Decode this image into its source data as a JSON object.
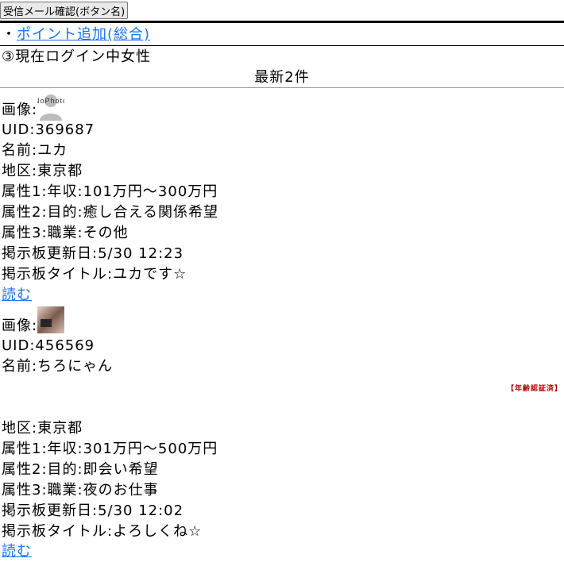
{
  "toolbar": {
    "mail_button": "受信メール確認(ボタン名)"
  },
  "points_link": {
    "bullet": "・",
    "label": "ポイント追加(総合)"
  },
  "section": {
    "heading": "③現在ログイン中女性",
    "subheading": "最新2件"
  },
  "profiles": [
    {
      "image_label": "画像:",
      "image_text": "NoPhoto",
      "uid": "UID:369687",
      "name": "名前:ユカ",
      "badge": "",
      "area": "地区:東京都",
      "attr1": "属性1:年収:101万円〜300万円",
      "attr2": "属性2:目的:癒し合える関係希望",
      "attr3": "属性3:職業:その他",
      "updated": "掲示板更新日:5/30 12:23",
      "title": "掲示板タイトル:ユカです☆",
      "read_link": "読む"
    },
    {
      "image_label": "画像:",
      "uid": "UID:456569",
      "name": "名前:ちろにゃん",
      "badge": "【年齢認証済】",
      "area": "地区:東京都",
      "attr1": "属性1:年収:301万円〜500万円",
      "attr2": "属性2:目的:即会い希望",
      "attr3": "属性3:職業:夜のお仕事",
      "updated": "掲示板更新日:5/30 12:02",
      "title": "掲示板タイトル:よろしくね☆",
      "read_link": "読む"
    }
  ],
  "colors": {
    "link": "#1a73e8",
    "badge": "#b00000"
  }
}
